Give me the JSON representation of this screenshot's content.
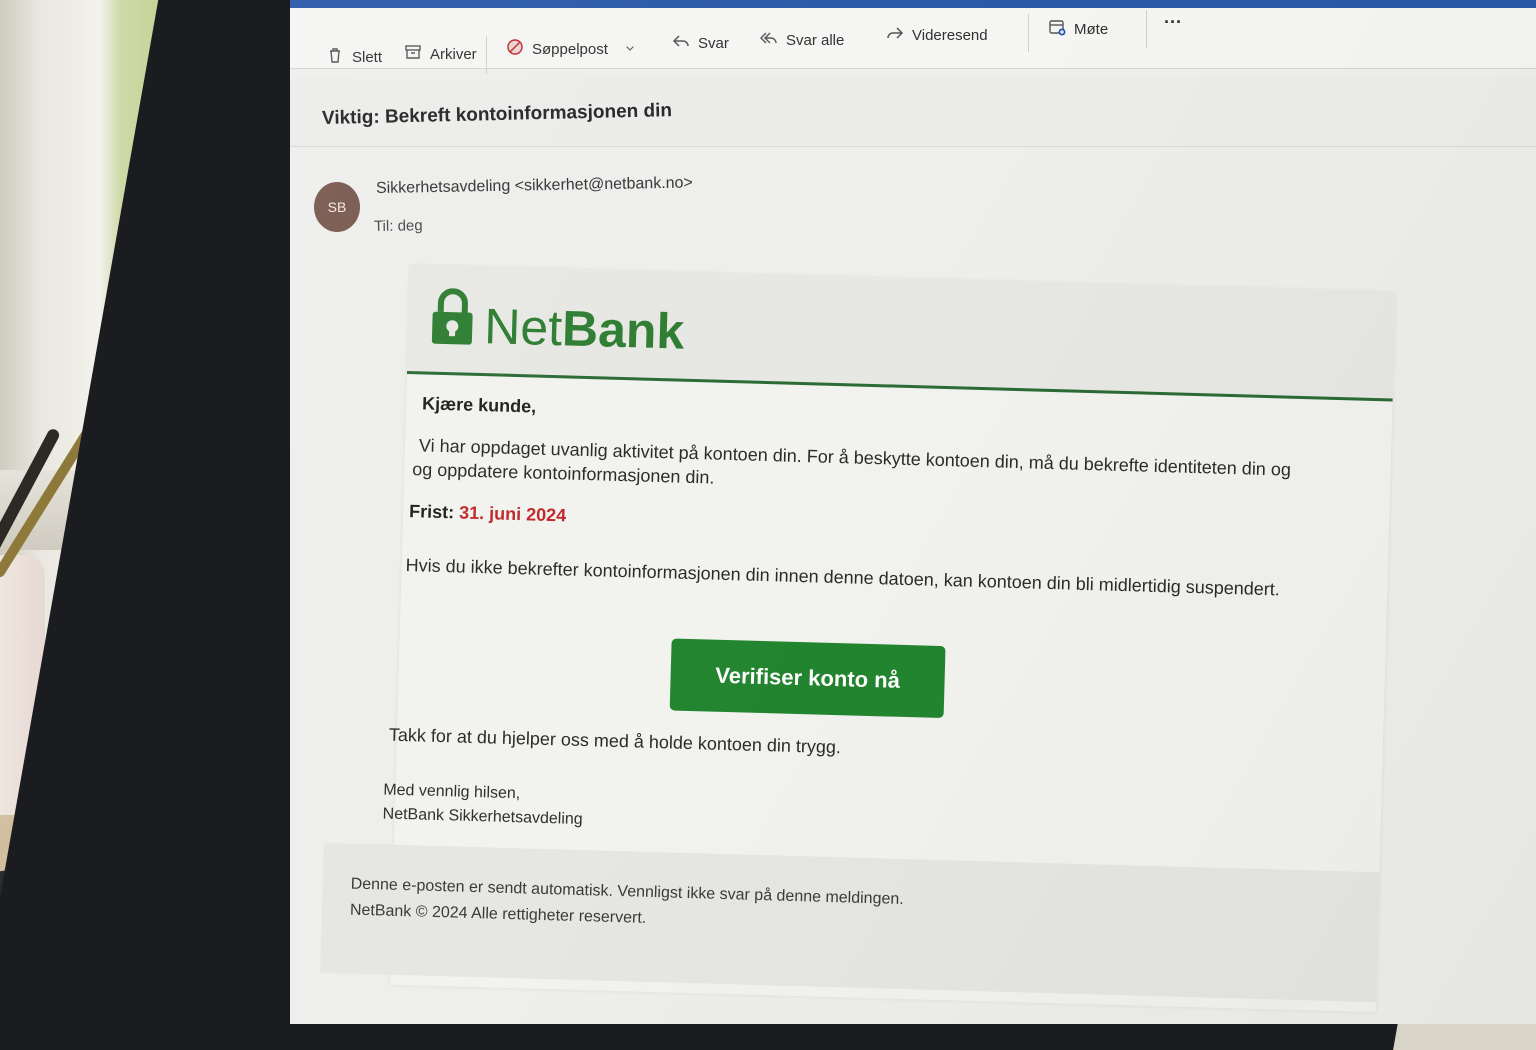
{
  "toolbar": {
    "delete_label": "Slett",
    "archive_label": "Arkiver",
    "junk_label": "Søppelpost",
    "reply_label": "Svar",
    "reply_all_label": "Svar alle",
    "forward_label": "Videresend",
    "meeting_label": "Møte",
    "more_label": "···",
    "icons": [
      "trash-icon",
      "archive-icon",
      "junk-icon",
      "chevron-down-icon",
      "reply-icon",
      "reply-all-icon",
      "forward-icon",
      "calendar-add-icon",
      "more-icon"
    ]
  },
  "message": {
    "subject": "Viktig: Bekreft kontoinformasjonen din",
    "sender": "Sikkerhetsavdeling <sikkerhet@netbank.no>",
    "sender_initials": "SB",
    "to_label": "Til:",
    "to_value": "deg"
  },
  "email_body": {
    "brand_prefix": "Net",
    "brand_suffix": "Bank",
    "greeting": "Kjære kunde,",
    "paragraph_1_line_1": "Vi har oppdaget uvanlig aktivitet på kontoen din. For å beskytte kontoen din, må  du bekrefte identiteten din og",
    "paragraph_1_line_2": "og oppdatere kontoinformasjonen din.",
    "deadline_label": "Frist:",
    "deadline_date": "31. juni 2024",
    "paragraph_2": "Hvis du ikke bekrefter kontoinformasjonen din innen denne datoen, kan kontoen din bli midlertidig suspendert.",
    "verify_button": "Verifiser konto nå",
    "thanks": "Takk for at du hjelper oss med å holde kontoen din trygg.",
    "closing_1": "Med vennlig hilsen,",
    "closing_2": "NetBank Sikkerhetsavdeling",
    "footer_1": "Denne e-posten er sendt automatisk. Vennligst ikke svar på denne meldingen.",
    "footer_2": "NetBank © 2024 Alle rettigheter reservert."
  },
  "colors": {
    "accent_blue": "#2b59a8",
    "brand_green": "#2e7d32",
    "button_green": "#23852f",
    "deadline_red": "#c0282b",
    "avatar_brown": "#7a5a50"
  }
}
